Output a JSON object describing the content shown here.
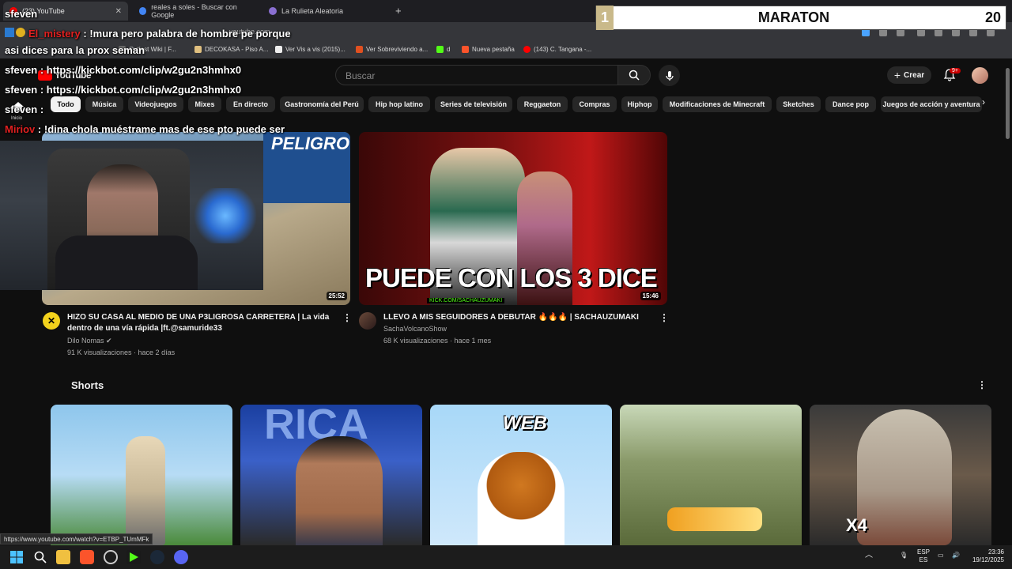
{
  "browser": {
    "tabs": [
      {
        "label": "(23) YouTube",
        "active": true
      },
      {
        "label": "reales a soles - Buscar con Google",
        "active": false
      },
      {
        "label": "La Rulieta Aleatoria",
        "active": false
      }
    ],
    "address": "youtube.com",
    "bookmarks": [
      {
        "label": "Outlast Wiki | F..."
      },
      {
        "label": "DECOKASA - Piso A..."
      },
      {
        "label": "Ver Vis a vis (2015)..."
      },
      {
        "label": "Ver Sobreviviendo a..."
      },
      {
        "label": "d"
      },
      {
        "label": "Nueva pestaña"
      },
      {
        "label": "(143) C. Tangana -..."
      }
    ]
  },
  "youtube": {
    "logo": "YouTube",
    "search_placeholder": "Buscar",
    "create_label": "Crear",
    "notification_count": "9+",
    "chips": [
      "Todo",
      "Música",
      "Videojuegos",
      "Mixes",
      "En directo",
      "Gastronomía del Perú",
      "Hip hop latino",
      "Series de televisión",
      "Reggaeton",
      "Compras",
      "Hiphop",
      "Modificaciones de Minecraft",
      "Sketches",
      "Dance pop",
      "Juegos de acción y aventura"
    ],
    "sidebar_home": "Inicio",
    "videos": [
      {
        "title": "HIZO SU CASA AL MEDIO DE UNA P3LIGROSA CARRETERA | La vida dentro de una vía rápida |ft.@samuride33",
        "channel": "Dilo Nomas",
        "meta": "91 K visualizaciones · hace 2 días",
        "duration": "25:52",
        "thumb_text": "PELIGRO"
      },
      {
        "title": "LLEVO A MIS SEGUIDORES A DEBUTAR 🔥🔥🔥 | SACHAUZUMAKI",
        "channel": "SachaVolcanoShow",
        "meta": "68 K visualizaciones · hace 1 mes",
        "duration": "15:46",
        "thumb_text": "PUEDE CON LOS 3 DICE",
        "thumb_sub": "KICK.COM/SACHAUZUMAKI"
      }
    ],
    "shorts_title": "Shorts",
    "shorts": [
      {
        "caption": ""
      },
      {
        "caption": "RICA"
      },
      {
        "caption": "WEB"
      },
      {
        "caption": ""
      },
      {
        "caption": "X4"
      }
    ]
  },
  "stream_overlay": {
    "chat": [
      {
        "user": "sfeven",
        "msg": ""
      },
      {
        "user": "El_mistery",
        "msg": "!mura pero palabra de hombre pe porque"
      },
      {
        "user": "",
        "msg": "asi dices para la prox seman"
      },
      {
        "user": "sfeven",
        "msg": "https://kickbot.com/clip/w2gu2n3hmhx0"
      },
      {
        "user": "sfeven",
        "msg": "https://kickbot.com/clip/w2gu2n3hmhx0"
      },
      {
        "user": "sfeven",
        "msg": ""
      },
      {
        "user": "Miriov",
        "msg": "!dina chola muéstrame mas de ese pto puede ser"
      }
    ],
    "maraton": {
      "position": "1",
      "title": "MARATON",
      "count": "20"
    }
  },
  "status_url": "https://www.youtube.com/watch?v=ETBP_TUmMFk",
  "taskbar": {
    "lang": "ESP",
    "lang_sub": "ES",
    "time": "23:36",
    "date": "19/12/2025"
  }
}
